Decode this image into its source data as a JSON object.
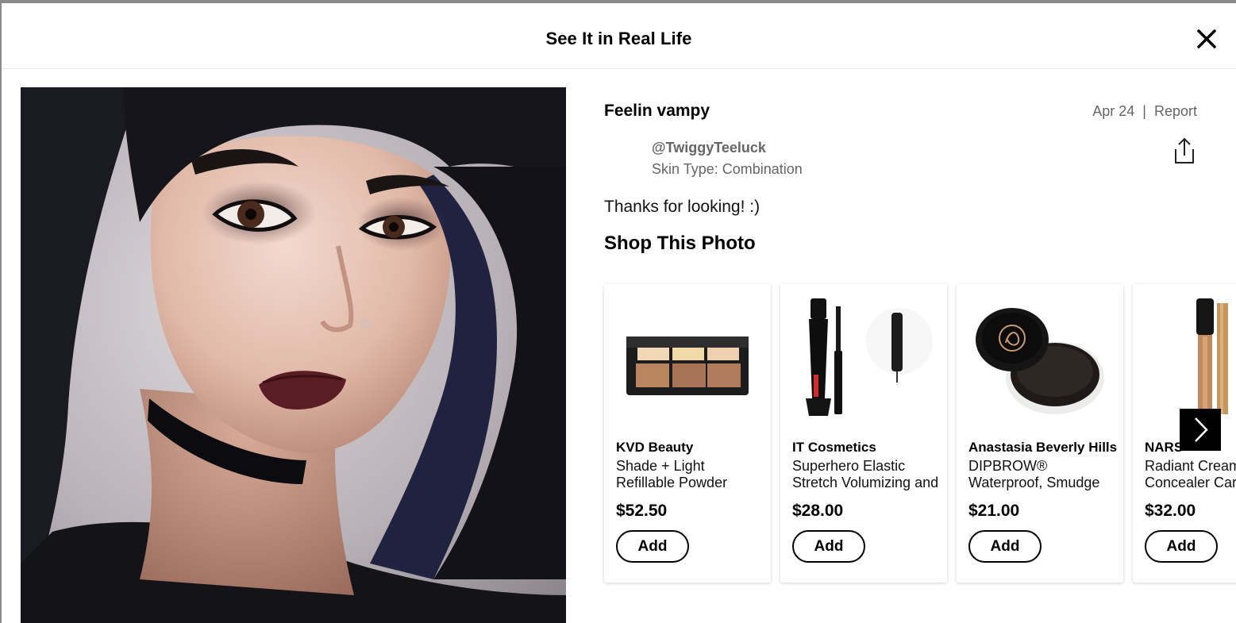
{
  "modal": {
    "title": "See It in Real Life",
    "close_icon": "close-icon"
  },
  "photo": {
    "icon": "photo-portrait"
  },
  "post": {
    "title": "Feelin vampy",
    "date": "Apr 24",
    "separator": "|",
    "report_label": "Report",
    "username": "@TwiggyTeeluck",
    "skin_type": "Skin Type: Combination",
    "caption": "Thanks for looking! :)",
    "share_icon": "share-icon"
  },
  "shop": {
    "heading": "Shop This Photo",
    "next_icon": "chevron-right-icon",
    "products": [
      {
        "brand": "KVD Beauty",
        "name": "Shade + Light Refillable Powder Face",
        "price": "$52.50",
        "add_label": "Add",
        "image_icon": "contour-palette"
      },
      {
        "brand": "IT Cosmetics",
        "name": "Superhero Elastic Stretch Volumizing and",
        "price": "$28.00",
        "add_label": "Add",
        "image_icon": "mascara"
      },
      {
        "brand": "Anastasia Beverly Hills",
        "name": "DIPBROW® Waterproof, Smudge",
        "price": "$21.00",
        "add_label": "Add",
        "image_icon": "brow-pomade-jar"
      },
      {
        "brand": "NARS",
        "name": "Radiant Creamy Concealer Caramel",
        "price": "$32.00",
        "add_label": "Add",
        "image_icon": "concealer-tube"
      }
    ]
  }
}
